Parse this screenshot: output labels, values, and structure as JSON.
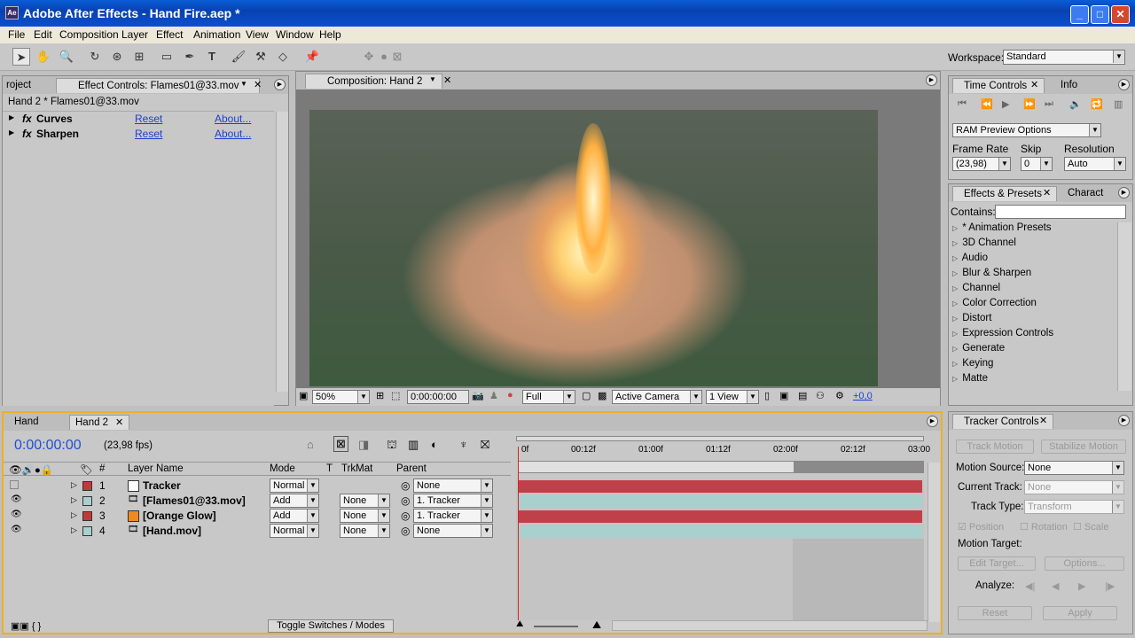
{
  "window": {
    "title": "Adobe After Effects - Hand Fire.aep *",
    "icon": "Ae"
  },
  "menu": [
    "File",
    "Edit",
    "Composition",
    "Layer",
    "Effect",
    "Animation",
    "View",
    "Window",
    "Help"
  ],
  "workspace": {
    "label": "Workspace:",
    "value": "Standard"
  },
  "effect_controls": {
    "tab_project": "roject",
    "tab_label": "Effect Controls: Flames01@33.mov",
    "breadcrumb": "Hand 2 * Flames01@33.mov",
    "effects": [
      {
        "name": "Curves",
        "reset": "Reset",
        "about": "About..."
      },
      {
        "name": "Sharpen",
        "reset": "Reset",
        "about": "About..."
      }
    ]
  },
  "composition": {
    "tab_label": "Composition: Hand 2",
    "zoom": "50%",
    "timecode": "0:00:00:00",
    "resolution": "Full",
    "camera": "Active Camera",
    "views": "1 View",
    "exposure": "+0,0"
  },
  "time_controls": {
    "tab1": "Time Controls",
    "tab2": "Info",
    "ram_preview": "RAM Preview Options",
    "frame_rate_label": "Frame Rate",
    "frame_rate": "(23,98)",
    "skip_label": "Skip",
    "skip": "0",
    "resolution_label": "Resolution",
    "resolution": "Auto"
  },
  "effects_presets": {
    "tab1": "Effects & Presets",
    "tab2": "Charact",
    "contains_label": "Contains:",
    "items": [
      "* Animation Presets",
      "3D Channel",
      "Audio",
      "Blur & Sharpen",
      "Channel",
      "Color Correction",
      "Distort",
      "Expression Controls",
      "Generate",
      "Keying",
      "Matte"
    ]
  },
  "timeline": {
    "tabs": [
      "Hand",
      "Hand 2"
    ],
    "timecode": "0:00:00:00",
    "fps": "(23,98 fps)",
    "headers": {
      "num": "#",
      "layer_name": "Layer Name",
      "mode": "Mode",
      "t": "T",
      "trkmat": "TrkMat",
      "parent": "Parent"
    },
    "ruler": [
      "0f",
      "00:12f",
      "01:00f",
      "01:12f",
      "02:00f",
      "02:12f",
      "03:00"
    ],
    "layers": [
      {
        "num": "1",
        "name": "Tracker",
        "label_color": "#c03a3a",
        "icon": "solid-white",
        "mode": "Normal",
        "trkmat": "",
        "parent": "None",
        "bar_color": "#c0404a"
      },
      {
        "num": "2",
        "name": "[Flames01@33.mov]",
        "label_color": "#a8d0cc",
        "icon": "footage",
        "mode": "Add",
        "trkmat": "None",
        "parent": "1. Tracker",
        "bar_color": "#a8d0cc"
      },
      {
        "num": "3",
        "name": "[Orange Glow]",
        "label_color": "#c03a3a",
        "icon": "solid-orange",
        "mode": "Add",
        "trkmat": "None",
        "parent": "1. Tracker",
        "bar_color": "#c0404a"
      },
      {
        "num": "4",
        "name": "[Hand.mov]",
        "label_color": "#a8d0cc",
        "icon": "footage",
        "mode": "Normal",
        "trkmat": "None",
        "parent": "None",
        "bar_color": "#a8d0cc"
      }
    ],
    "toggle_label": "Toggle Switches / Modes"
  },
  "tracker": {
    "tab": "Tracker Controls",
    "track_motion": "Track Motion",
    "stabilize_motion": "Stabilize Motion",
    "motion_source_label": "Motion Source:",
    "motion_source": "None",
    "current_track_label": "Current Track:",
    "current_track": "None",
    "track_type_label": "Track Type:",
    "track_type": "Transform",
    "position": "Position",
    "rotation": "Rotation",
    "scale": "Scale",
    "motion_target_label": "Motion Target:",
    "edit_target": "Edit Target...",
    "options": "Options...",
    "analyze_label": "Analyze:",
    "reset": "Reset",
    "apply": "Apply"
  }
}
